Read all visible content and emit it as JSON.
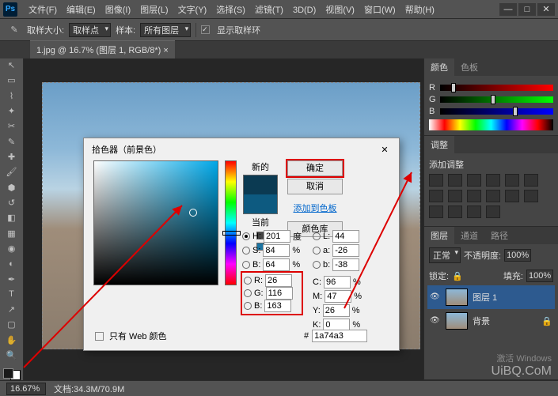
{
  "menu": {
    "items": [
      "文件(F)",
      "编辑(E)",
      "图像(I)",
      "图层(L)",
      "文字(Y)",
      "选择(S)",
      "滤镜(T)",
      "3D(D)",
      "视图(V)",
      "窗口(W)",
      "帮助(H)"
    ]
  },
  "options": {
    "sample_size_label": "取样大小:",
    "sample_size_val": "取样点",
    "sample_label": "样本:",
    "sample_val": "所有图层",
    "show_ring": "显示取样环"
  },
  "doc": {
    "tab": "1.jpg @ 16.7% (图层 1, RGB/8*) ×"
  },
  "panels": {
    "color": {
      "tab1": "颜色",
      "tab2": "色板",
      "r": "R",
      "g": "G",
      "b": "B"
    },
    "adjust": {
      "tab": "调整",
      "add": "添加调整"
    },
    "layers": {
      "tab1": "图层",
      "tab2": "通道",
      "tab3": "路径",
      "blend": "正常",
      "opacity_lbl": "不透明度:",
      "opacity": "100%",
      "lock_lbl": "锁定:",
      "fill_lbl": "填充:",
      "fill": "100%",
      "items": [
        {
          "name": "图层 1"
        },
        {
          "name": "背景"
        }
      ]
    }
  },
  "dialog": {
    "title": "拾色器（前景色）",
    "new_lbl": "新的",
    "cur_lbl": "当前",
    "ok": "确定",
    "cancel": "取消",
    "add": "添加到色板",
    "libs": "颜色库",
    "H": "H:",
    "Hv": "201",
    "Hdeg": "度",
    "S": "S:",
    "Sv": "84",
    "Spct": "%",
    "Bv_lbl": "B:",
    "Bv": "64",
    "Bpct": "%",
    "R": "R:",
    "Rv": "26",
    "G": "G:",
    "Gv": "116",
    "B": "B:",
    "Bvv": "163",
    "L": "L:",
    "Lv": "44",
    "a": "a:",
    "av": "-26",
    "b_lab": "b:",
    "bv": "-38",
    "C": "C:",
    "Cv": "96",
    "Cpct": "%",
    "M": "M:",
    "Mv": "47",
    "Mpct": "%",
    "Y": "Y:",
    "Yv": "26",
    "Ypct": "%",
    "K": "K:",
    "Kv": "0",
    "Kpct": "%",
    "web": "只有 Web 颜色",
    "hex_lbl": "#",
    "hex": "1a74a3"
  },
  "status": {
    "zoom": "16.67%",
    "doc": "文档:34.3M/70.9M"
  },
  "watermark": {
    "l1": "激活 Windows",
    "l2": "UiBQ.CoM"
  }
}
